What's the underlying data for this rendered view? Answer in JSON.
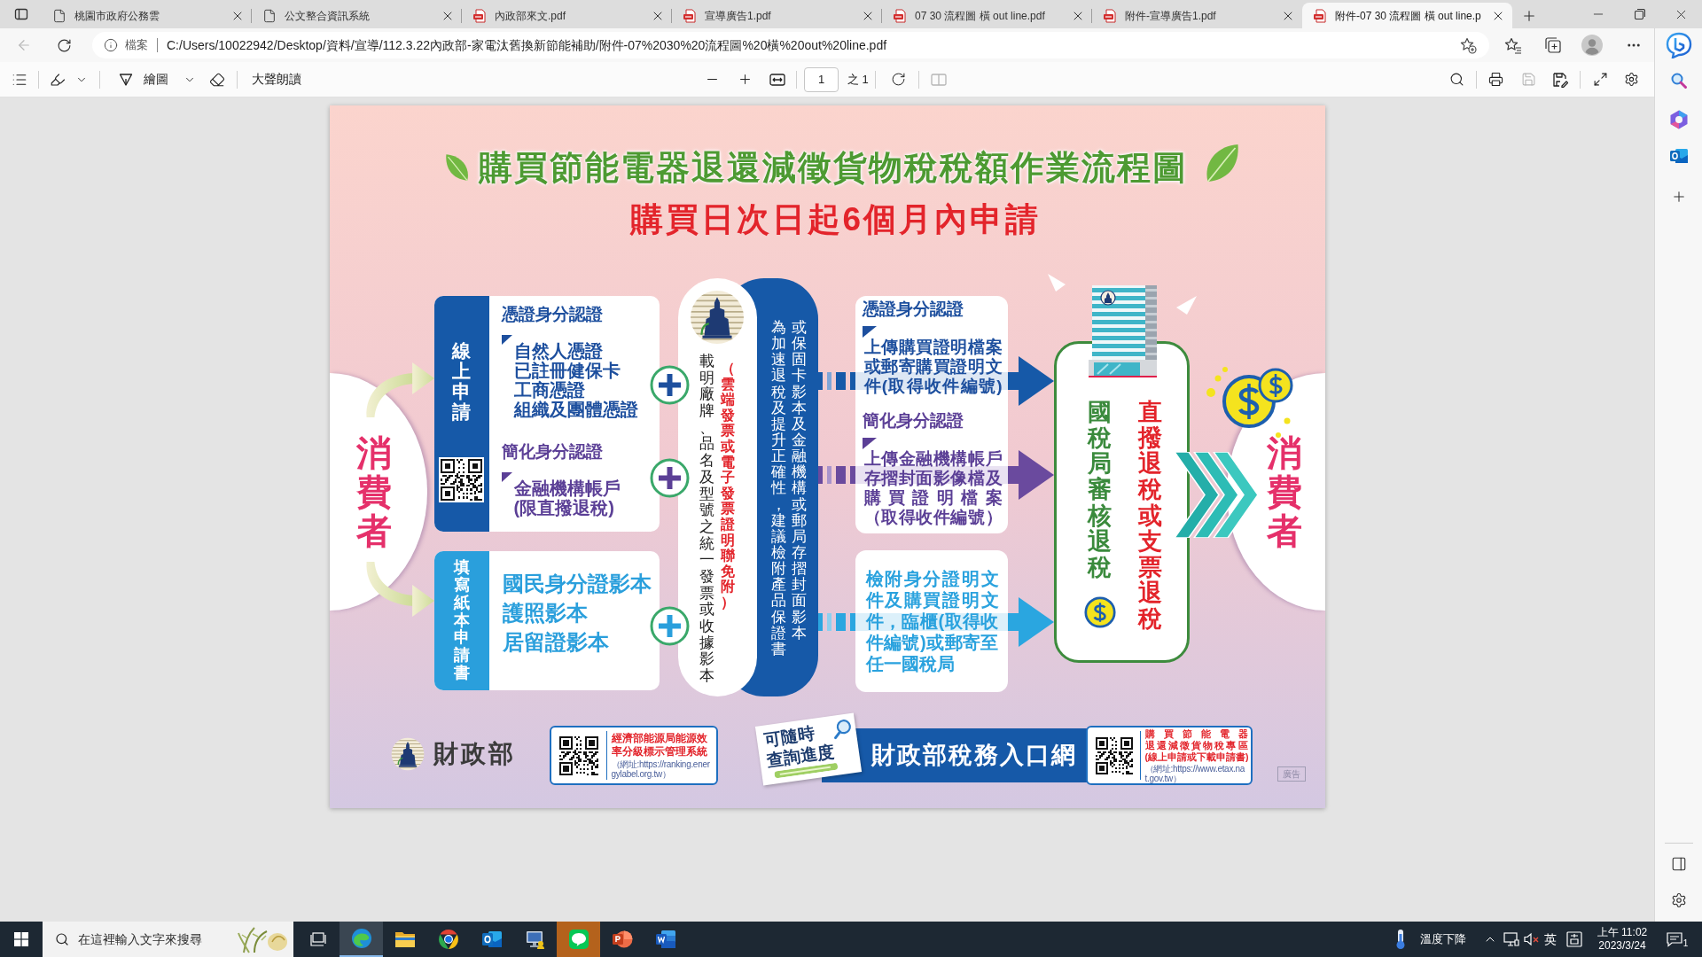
{
  "window": {
    "tabs": [
      {
        "title": "桃園市政府公務雲",
        "kind": "page",
        "selected": false
      },
      {
        "title": "公文整合資訊系統",
        "kind": "page",
        "selected": false
      },
      {
        "title": "內政部來文.pdf",
        "kind": "pdf",
        "selected": false
      },
      {
        "title": "宣導廣告1.pdf",
        "kind": "pdf",
        "selected": false
      },
      {
        "title": "07 30 流程圖 橫 out line.pdf",
        "kind": "pdf",
        "selected": false
      },
      {
        "title": "附件-宣導廣告1.pdf",
        "kind": "pdf",
        "selected": false
      },
      {
        "title": "附件-07 30 流程圖 橫 out line.p",
        "kind": "pdf",
        "selected": true
      }
    ]
  },
  "address_bar": {
    "back_disabled": true,
    "scheme_label": "檔案",
    "url": "C:/Users/10022942/Desktop/資料/宣導/112.3.22內政部-家電汰舊換新節能補助/附件-07%2030%20流程圖%20橫%20out%20line.pdf"
  },
  "pdf_toolbar": {
    "draw_label": "繪圖",
    "read_aloud_label": "大聲朗讀",
    "page_number": "1",
    "page_total": "之 1",
    "page_view_disabled": true,
    "save_disabled": true
  },
  "poster": {
    "title": "購買節能電器退還減徵貨物稅稅額作業流程圖",
    "subtitle": "購買日次日起6個月內申請",
    "consumer_left": "消費者",
    "online_application": {
      "label": "線上申請",
      "groups": [
        {
          "heading": "憑證身分認證",
          "color": "#1d4f9e",
          "items": [
            {
              "lines": [
                "自然人憑證"
              ]
            },
            {
              "lines": [
                "已註冊健保卡"
              ]
            },
            {
              "lines": [
                "工商憑證"
              ]
            },
            {
              "lines": [
                "組織及團體憑證"
              ]
            }
          ]
        },
        {
          "heading": "簡化身分認證",
          "color": "#5b3f96",
          "items": [
            {
              "lines": [
                "金融機構帳戶",
                "(限直撥退稅)"
              ]
            }
          ]
        }
      ]
    },
    "paper_application": {
      "label": "填寫紙本申請書",
      "items": [
        "國民身分證影本",
        "護照影本",
        "居留證影本"
      ]
    },
    "documents": {
      "columns": [
        {
          "kind": "main",
          "text": "載明廠牌、品名及型號之統一發票或收據影本"
        },
        {
          "kind": "note",
          "text": "（雲端發票或電子發票證明聯免附）"
        }
      ]
    },
    "advice": {
      "columns": [
        "為加速退稅及提升正確性，建議檢附產品保證書",
        "或保固卡影本及金融機構或郵局存摺封面影本"
      ]
    },
    "online_submission": {
      "groups": [
        {
          "heading": "憑證身分認證",
          "color": "#1d4f9e",
          "lines": [
            "上傳購買證明檔案",
            "或郵寄購買證明文",
            "件(取得收件編號)"
          ]
        },
        {
          "heading": "簡化身分認證",
          "color": "#5b3f96",
          "lines": [
            "上傳金融機構帳戶",
            "存摺封面影像檔及",
            "購買證明檔案",
            "（取得收件編號）"
          ]
        }
      ]
    },
    "paper_submission": {
      "lines": [
        "檢附身分證明文",
        "件及購買證明文",
        "件，臨櫃(取得收",
        "件編號)或郵寄至",
        "任一國稅局"
      ]
    },
    "tax_office": {
      "review": "國稅局審核退稅",
      "refund": "直撥退稅或支票退稅"
    },
    "consumer_right": "消費者",
    "footer": {
      "ministry": "財政部",
      "energy_box": {
        "lines": [
          "經濟部能源局能源效",
          "率分級標示管理系統"
        ],
        "url_note": "（網址:https://ranking.energylabel.org.tw）"
      },
      "progress_tag": {
        "lines": [
          "可隨時",
          "查詢進度"
        ]
      },
      "portal": "財政部稅務入口網",
      "etax_box": {
        "lines": [
          "購買節能電器",
          "退還減徵貨物稅專區",
          "(線上申請或下載申請書)"
        ],
        "url_note": "（網址:https://www.etax.nat.gov.tw）"
      },
      "ad_label": "廣告"
    }
  },
  "taskbar": {
    "search_placeholder": "在這裡輸入文字來搜尋",
    "apps": [
      {
        "kind": "edge",
        "active": true,
        "attention": false
      },
      {
        "kind": "explorer",
        "active": false,
        "attention": false
      },
      {
        "kind": "chrome",
        "active": false,
        "attention": false
      },
      {
        "kind": "outlook",
        "active": false,
        "attention": false
      },
      {
        "kind": "monitor",
        "active": false,
        "attention": false
      },
      {
        "kind": "line",
        "active": false,
        "attention": true
      },
      {
        "kind": "powerpoint",
        "active": false,
        "attention": false
      },
      {
        "kind": "word",
        "active": false,
        "attention": false
      }
    ],
    "weather": "溫度下降",
    "input_language": "英",
    "time": "上午 11:02",
    "date": "2023/3/24",
    "notification_count": "1"
  }
}
